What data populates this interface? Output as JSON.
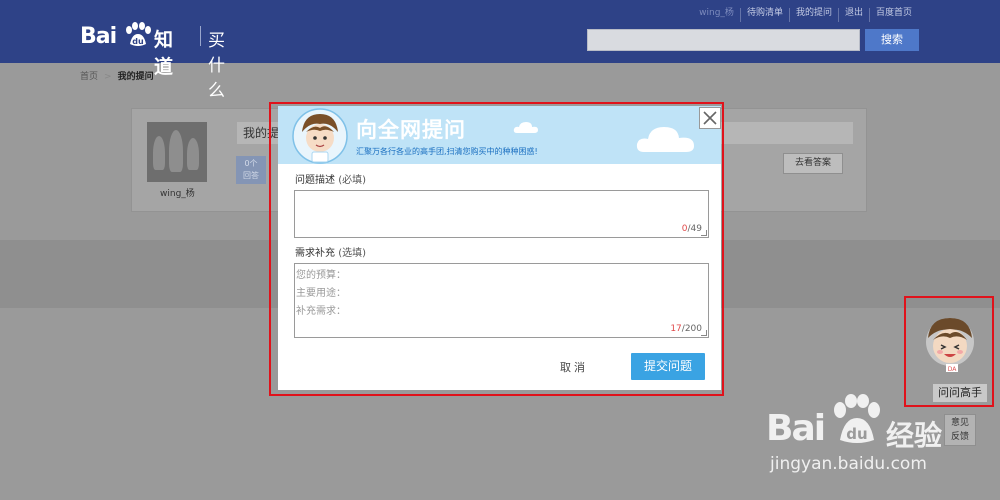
{
  "header": {
    "brand": {
      "bai": "Bai",
      "zhidao": "知道",
      "channel": "买什么"
    },
    "links": [
      "wing_杨",
      "待购清单",
      "我的提问",
      "退出",
      "百度首页"
    ],
    "search": {
      "value": "",
      "button": "搜索"
    }
  },
  "breadcrumb": {
    "home": "首页",
    "separator": ">",
    "current": "我的提问"
  },
  "background_card": {
    "username": "wing_杨",
    "question_title": "我的提",
    "stat_number": "0个",
    "stat_label": "回答",
    "action_button": "去看答案"
  },
  "modal": {
    "title": "向全网提问",
    "subtitle": "汇聚万各行各业的高手团,扫清您购买中的种种困惑!",
    "close_icon": "close-icon",
    "description_field": {
      "label": "问题描述",
      "note": "(必填)",
      "value": "",
      "counter_used": "0",
      "counter_max": "/49"
    },
    "supplement_field": {
      "label": "需求补充",
      "note": "(选填)",
      "lines": [
        "您的预算：",
        "主要用途：",
        "补充需求："
      ],
      "counter_used": "17",
      "counter_max": "/200"
    },
    "cancel_label": "取消",
    "submit_label": "提交问题"
  },
  "helper": {
    "label": "问问高手",
    "badge": "DA",
    "feedback": [
      "意见",
      "反馈"
    ]
  },
  "watermark": {
    "brand": "Bai",
    "product": "经验",
    "url": "jingyan.baidu.com"
  },
  "colors": {
    "header_bg": "#2e4287",
    "banner_bg": "#bfe3f7",
    "submit_bg": "#3aa3e3",
    "highlight_red": "#e0121b",
    "overlay_gray": "#9a9a9a"
  }
}
